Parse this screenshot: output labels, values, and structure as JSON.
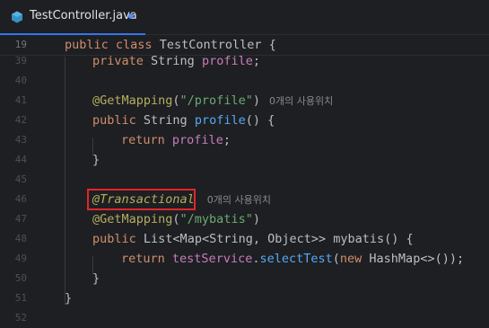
{
  "tab": {
    "filename": "TestController.java",
    "modified": true,
    "icon": "java-class-icon"
  },
  "sticky_line": {
    "number": "19",
    "keyword_public": "public",
    "keyword_class": "class",
    "class_name": "TestController",
    "brace": "{"
  },
  "lines": [
    {
      "number": "39"
    },
    {
      "number": "40"
    },
    {
      "number": "41"
    },
    {
      "number": "42"
    },
    {
      "number": "43"
    },
    {
      "number": "44"
    },
    {
      "number": "45"
    },
    {
      "number": "46"
    },
    {
      "number": "47"
    },
    {
      "number": "48"
    },
    {
      "number": "49"
    },
    {
      "number": "50"
    },
    {
      "number": "51"
    },
    {
      "number": "52"
    }
  ],
  "code": {
    "l39": {
      "kw": "private",
      "type": "String",
      "field": "profile",
      "end": ";"
    },
    "l41": {
      "ann": "@GetMapping",
      "open": "(",
      "str": "\"/profile\"",
      "close": ")",
      "hint": "0개의 사용위치"
    },
    "l42": {
      "kw": "public",
      "type": "String",
      "method": "profile",
      "rest": "() {"
    },
    "l43": {
      "kw": "return",
      "field": "profile",
      "end": ";"
    },
    "l44": {
      "brace": "}"
    },
    "l46": {
      "ann": "@Transactional",
      "hint": "0개의 사용위치"
    },
    "l47": {
      "ann": "@GetMapping",
      "open": "(",
      "str": "\"/mybatis\"",
      "close": ")"
    },
    "l48": {
      "kw": "public",
      "type": "List<Map<String, Object>>",
      "method": "mybatis",
      "rest": "() {"
    },
    "l49": {
      "kw": "return",
      "field": "testService",
      "dot": ".",
      "method": "selectTest",
      "open": "(",
      "kw2": "new",
      "type": "HashMap<>",
      "rest": "());"
    },
    "l50": {
      "brace": "}"
    },
    "l51": {
      "brace": "}"
    }
  },
  "colors": {
    "background": "#1e1f22",
    "keyword": "#cf8e6d",
    "annotation": "#b3ae60",
    "string": "#6aab73",
    "field": "#c77dbb",
    "method": "#56a8f5",
    "highlight_box": "#e0262a"
  }
}
